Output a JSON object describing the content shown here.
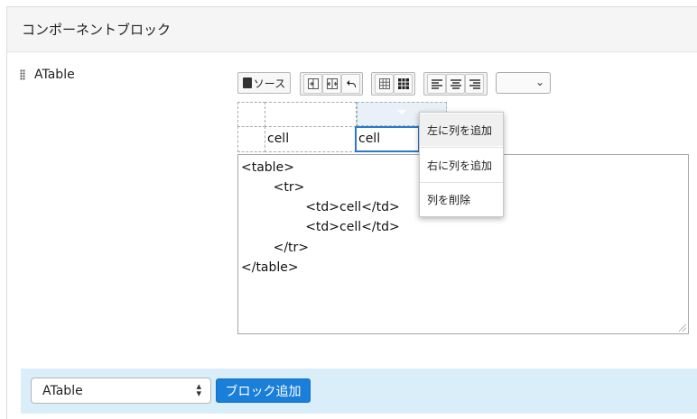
{
  "panel": {
    "title": "コンポーネントブロック"
  },
  "block": {
    "name": "ATable"
  },
  "toolbar": {
    "source_label": "ソース",
    "select_value": ""
  },
  "table_editor": {
    "cells": [
      "cell",
      "cell"
    ]
  },
  "code_lines": [
    "<table>",
    "        <tr>",
    "                <td>cell</td>",
    "                <td>cell</td>",
    "        </tr>",
    "</table>"
  ],
  "context_menu": {
    "items": [
      "左に列を追加",
      "右に列を追加",
      "列を削除"
    ]
  },
  "footer": {
    "select_value": "ATable",
    "add_button": "ブロック追加"
  },
  "colors": {
    "accent": "#1a7fd9",
    "footer_bg": "#d9eef9",
    "selected_border": "#2d78c8"
  }
}
